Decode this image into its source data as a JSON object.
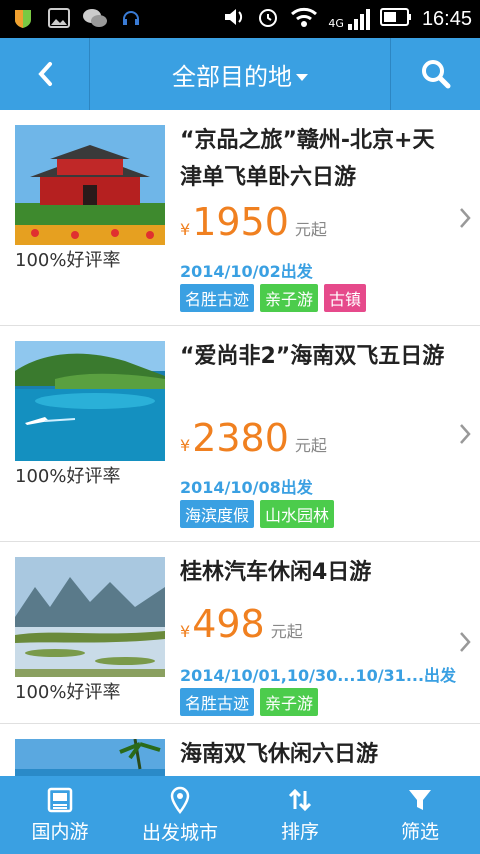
{
  "status_bar": {
    "time": "16:45",
    "network": "4G"
  },
  "header": {
    "title": "全部目的地"
  },
  "items": [
    {
      "title": "“京品之旅”赣州-北京+天津单飞单卧六日游",
      "currency": "¥",
      "price": "1950",
      "unit": "元起",
      "date": "2014/10/02出发",
      "rating": "100%好评率",
      "tags": [
        {
          "label": "名胜古迹",
          "color": "#3aa0e2"
        },
        {
          "label": "亲子游",
          "color": "#4ccc4c"
        },
        {
          "label": "古镇",
          "color": "#e64a8b"
        }
      ]
    },
    {
      "title": "“爱尚非2”海南双飞五日游",
      "currency": "¥",
      "price": "2380",
      "unit": "元起",
      "date": "2014/10/08出发",
      "rating": "100%好评率",
      "tags": [
        {
          "label": "海滨度假",
          "color": "#3aa0e2"
        },
        {
          "label": "山水园林",
          "color": "#4ccc4c"
        }
      ]
    },
    {
      "title": "桂林汽车休闲4日游",
      "currency": "¥",
      "price": "498",
      "unit": "元起",
      "date": "2014/10/01,10/30...10/31...出发",
      "rating": "100%好评率",
      "tags": [
        {
          "label": "名胜古迹",
          "color": "#3aa0e2"
        },
        {
          "label": "亲子游",
          "color": "#4ccc4c"
        }
      ]
    },
    {
      "title": "海南双飞休闲六日游"
    }
  ],
  "bottom_nav": [
    {
      "label": "国内游",
      "icon": "domestic-travel-icon"
    },
    {
      "label": "出发城市",
      "icon": "location-pin-icon"
    },
    {
      "label": "排序",
      "icon": "sort-icon"
    },
    {
      "label": "筛选",
      "icon": "filter-icon"
    }
  ]
}
